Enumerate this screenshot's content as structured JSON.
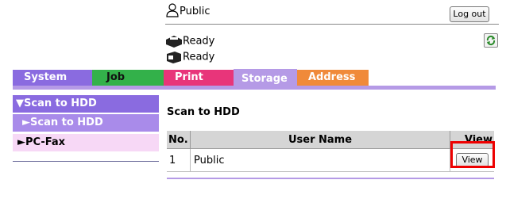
{
  "header": {
    "user_label": "Public",
    "logout_label": "Log out",
    "status_1": "Ready",
    "status_2": "Ready"
  },
  "tabs": [
    {
      "label": "System"
    },
    {
      "label": "Job"
    },
    {
      "label": "Print"
    },
    {
      "label": "Storage"
    },
    {
      "label": "Address"
    }
  ],
  "sidebar": {
    "section": "▼Scan to HDD",
    "item": "►Scan to HDD",
    "fax": "►PC-Fax"
  },
  "main": {
    "title": "Scan to HDD",
    "columns": [
      "No.",
      "User Name",
      "View"
    ],
    "rows": [
      {
        "no": "1",
        "name": "Public",
        "action": "View"
      }
    ]
  },
  "colors": {
    "system": "#8a6be0",
    "job": "#33b14a",
    "print": "#e8357a",
    "storage": "#b59ae6",
    "address": "#f08a3a",
    "highlight": "#e00000"
  }
}
